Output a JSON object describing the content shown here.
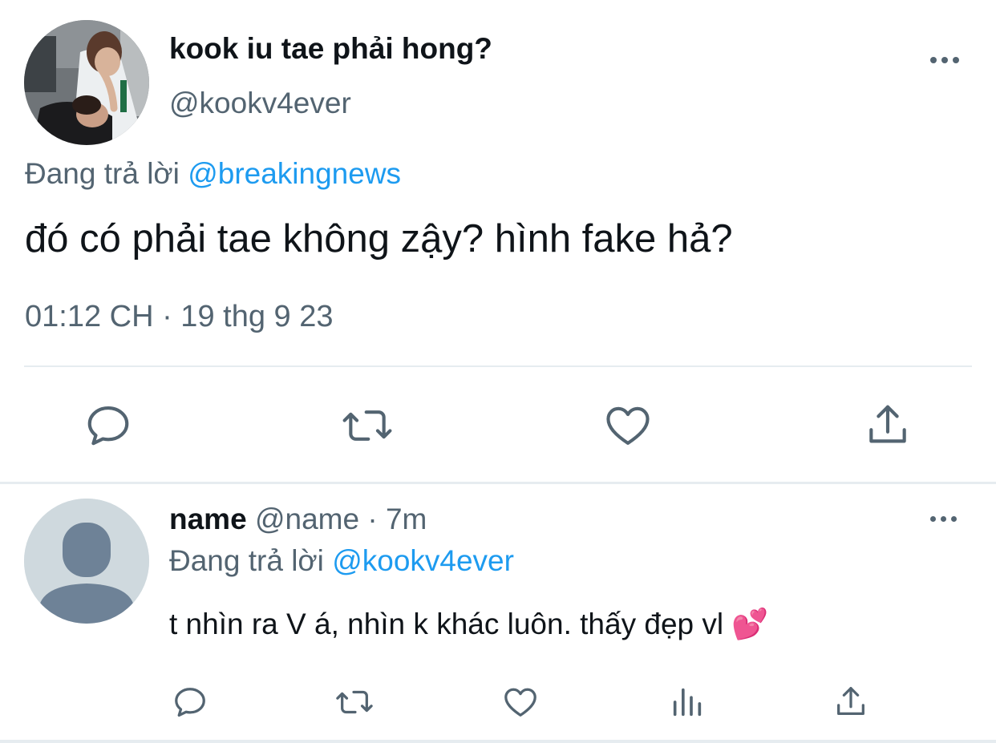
{
  "main_tweet": {
    "display_name": "kook iu tae phải hong?",
    "handle": "@kookv4ever",
    "reply_prefix": "Đang trả lời",
    "reply_to": "@breakingnews",
    "text": "đó có phải tae không zậy? hình fake hả?",
    "timestamp": "01:12 CH · 19 thg 9 23",
    "actions": [
      "reply-icon",
      "retweet-icon",
      "like-icon",
      "share-icon"
    ]
  },
  "reply_tweet": {
    "display_name": "name",
    "handle": "@name",
    "separator": "·",
    "age": "7m",
    "reply_prefix": "Đang trả lời",
    "reply_to": "@kookv4ever",
    "text": "t nhìn ra V á, nhìn k khác luôn. thấy đẹp vl",
    "emoji": "💕",
    "actions": [
      "reply-icon",
      "retweet-icon",
      "like-icon",
      "analytics-icon",
      "share-icon"
    ]
  },
  "colors": {
    "text_primary": "#0f1419",
    "text_secondary": "#536471",
    "accent": "#1d9bf0",
    "divider": "#e6ecf0",
    "icon": "#536471",
    "default_avatar_bg": "#cfd9de",
    "default_avatar_fg": "#6e8297"
  }
}
